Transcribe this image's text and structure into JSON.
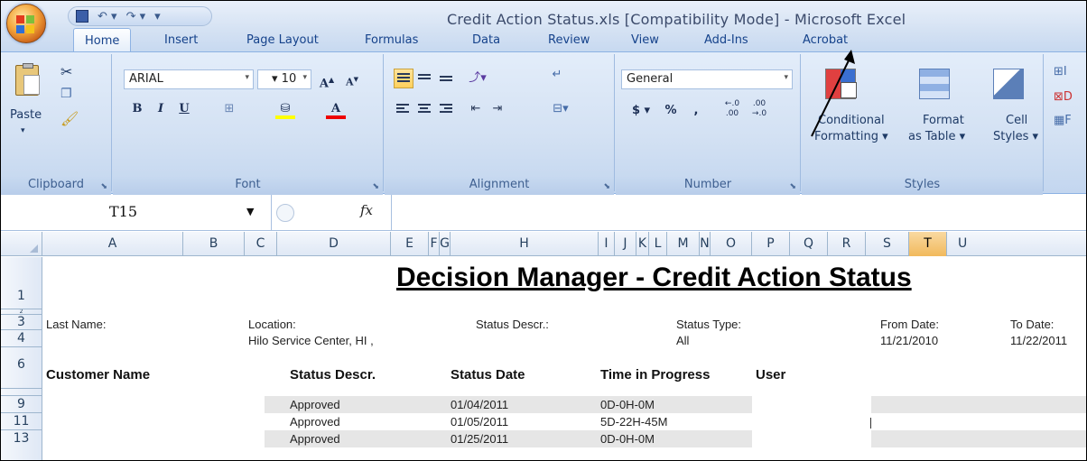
{
  "window": {
    "title": "Credit Action Status.xls  [Compatibility Mode] - Microsoft Excel"
  },
  "quick_access": {
    "save_icon": "save-icon",
    "undo_icon": "undo-icon",
    "redo_icon": "redo-icon"
  },
  "tabs": [
    "Home",
    "Insert",
    "Page Layout",
    "Formulas",
    "Data",
    "Review",
    "View",
    "Add-Ins",
    "Acrobat"
  ],
  "ribbon": {
    "clipboard": {
      "label": "Clipboard",
      "paste": "Paste"
    },
    "font": {
      "label": "Font",
      "name": "ARIAL",
      "size": "10"
    },
    "alignment": {
      "label": "Alignment"
    },
    "number": {
      "label": "Number",
      "format": "General",
      "dollar": "$",
      "percent": "%",
      "comma": ","
    },
    "styles": {
      "label": "Styles",
      "conditional1": "Conditional",
      "conditional2": "Formatting ▾",
      "format1": "Format",
      "format2": "as Table ▾",
      "cell1": "Cell",
      "cell2": "Styles ▾"
    }
  },
  "formula_bar": {
    "name_box": "T15",
    "fx": "fx",
    "value": ""
  },
  "columns": [
    "A",
    "B",
    "C",
    "D",
    "E",
    "F",
    "G",
    "H",
    "I",
    "J",
    "K",
    "L",
    "M",
    "N",
    "O",
    "P",
    "Q",
    "R",
    "S",
    "T",
    "U"
  ],
  "selected_column": "T",
  "row_numbers": [
    "1",
    "2",
    "3",
    "4",
    "6",
    "9",
    "11",
    "13"
  ],
  "sheet": {
    "title": "Decision Manager - Credit Action Status",
    "labels": {
      "last_name": "Last Name:",
      "location": "Location:",
      "status_descr": "Status Descr.:",
      "status_type": "Status Type:",
      "from_date": "From Date:",
      "to_date": "To Date:"
    },
    "values": {
      "location": "Hilo Service Center, HI ,",
      "status_type": "All",
      "from_date": "11/21/2010",
      "to_date": "11/22/2011"
    },
    "headers": {
      "customer_name": "Customer Name",
      "status_descr": "Status Descr.",
      "status_date": "Status Date",
      "time_in_progress": "Time in Progress",
      "user": "User"
    },
    "rows": [
      {
        "status": "Approved",
        "date": "01/04/2011",
        "time": "0D-0H-0M"
      },
      {
        "status": "Approved",
        "date": "01/05/2011",
        "time": "5D-22H-45M"
      },
      {
        "status": "Approved",
        "date": "01/25/2011",
        "time": "0D-0H-0M"
      }
    ]
  }
}
